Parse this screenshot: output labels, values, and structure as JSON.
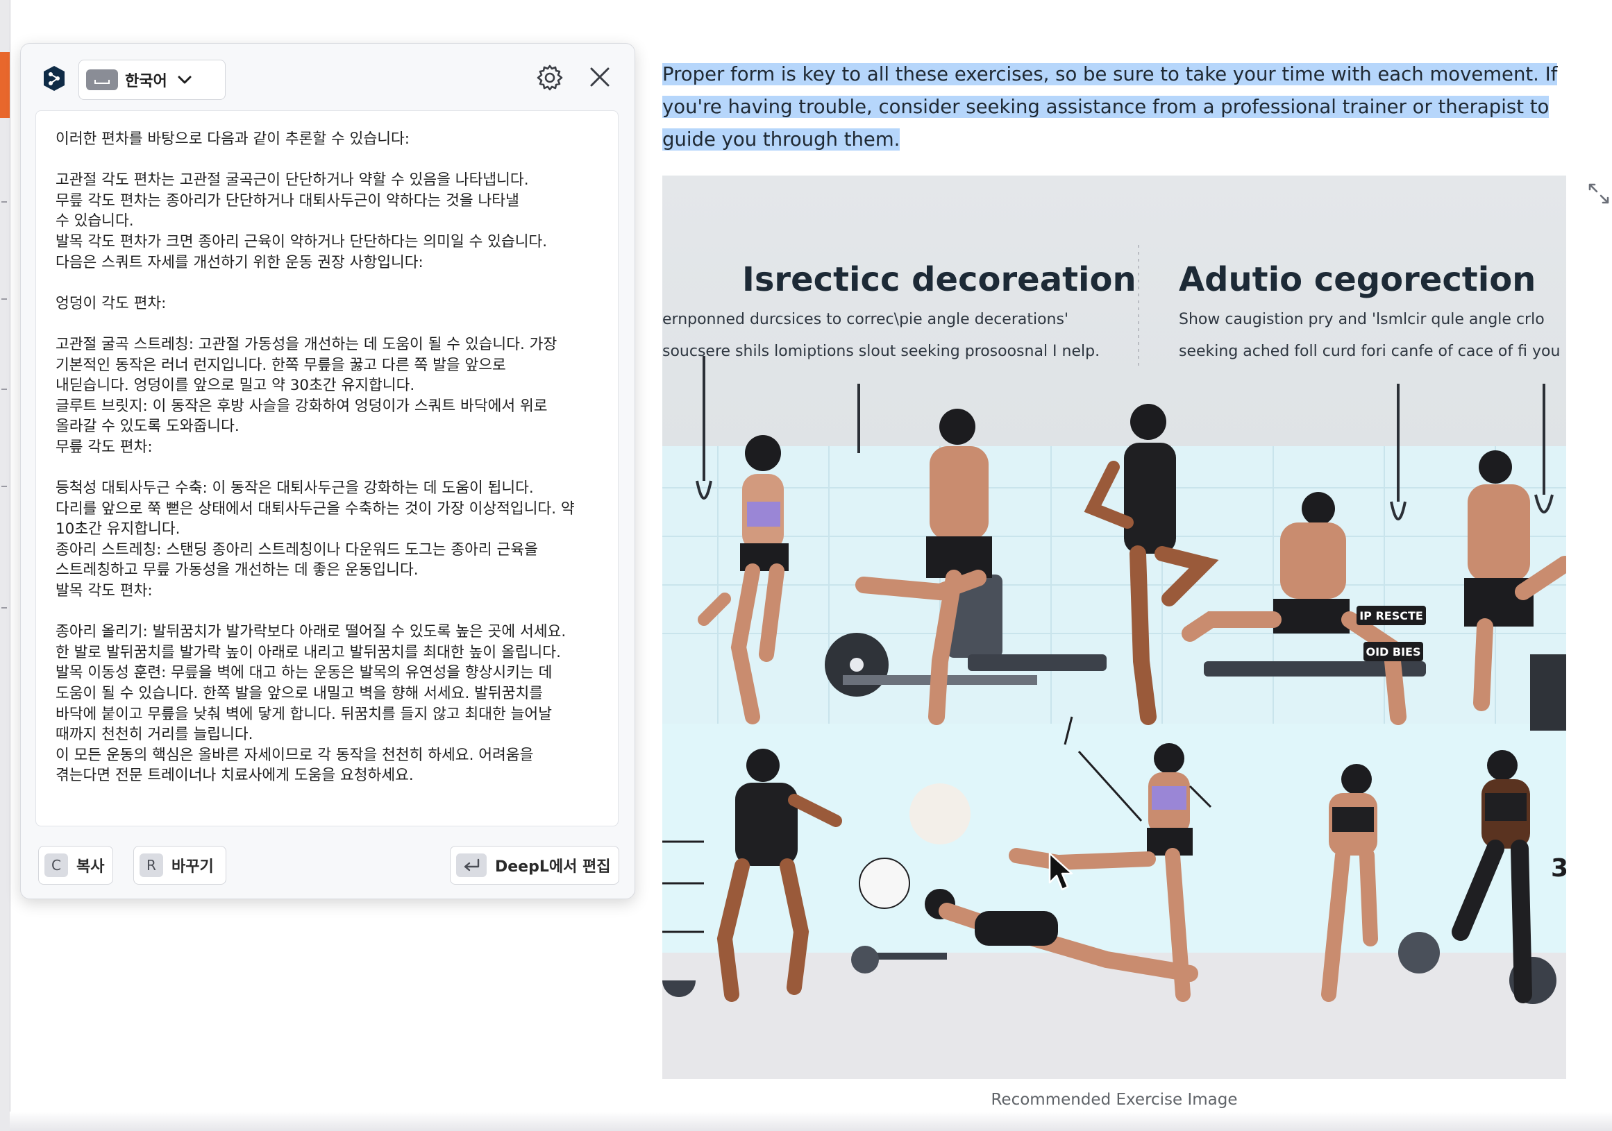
{
  "translator": {
    "language": "한국어",
    "text_lines": [
      "이러한 편차를 바탕으로 다음과 같이 추론할 수 있습니다:",
      "",
      "고관절 각도 편차는 고관절 굴곡근이 단단하거나 약할 수 있음을 나타냅니다.",
      "무릎 각도 편차는 종아리가 단단하거나 대퇴사두근이 약하다는 것을 나타낼",
      "수 있습니다.",
      "발목 각도 편차가 크면 종아리 근육이 약하거나 단단하다는 의미일 수 있습니다.",
      "다음은 스쿼트 자세를 개선하기 위한 운동 권장 사항입니다:",
      "",
      "엉덩이 각도 편차:",
      "",
      "고관절 굴곡 스트레칭: 고관절 가동성을 개선하는 데 도움이 될 수 있습니다. 가장",
      "기본적인 동작은 러너 런지입니다. 한쪽 무릎을 꿇고 다른 쪽 발을 앞으로",
      "내딛습니다. 엉덩이를 앞으로 밀고 약 30초간 유지합니다.",
      "글루트 브릿지: 이 동작은 후방 사슬을 강화하여 엉덩이가 스쿼트 바닥에서 위로",
      "올라갈 수 있도록 도와줍니다.",
      "무릎 각도 편차:",
      "",
      "등척성 대퇴사두근 수축: 이 동작은 대퇴사두근을 강화하는 데 도움이 됩니다.",
      "다리를 앞으로 쭉 뻗은 상태에서 대퇴사두근을 수축하는 것이 가장 이상적입니다. 약",
      "10초간 유지합니다.",
      "종아리 스트레칭: 스탠딩 종아리 스트레칭이나 다운워드 도그는 종아리 근육을",
      "스트레칭하고 무릎 가동성을 개선하는 데 좋은 운동입니다.",
      "발목 각도 편차:",
      "",
      "종아리 올리기: 발뒤꿈치가 발가락보다 아래로 떨어질 수 있도록 높은 곳에 서세요.",
      "한 발로 발뒤꿈치를 발가락 높이 아래로 내리고 발뒤꿈치를 최대한 높이 올립니다.",
      "발목 이동성 훈련: 무릎을 벽에 대고 하는 운동은 발목의 유연성을 향상시키는 데",
      "도움이 될 수 있습니다. 한쪽 발을 앞으로 내밀고 벽을 향해 서세요. 발뒤꿈치를",
      "바닥에 붙이고 무릎을 낮춰 벽에 닿게 합니다. 뒤꿈치를 들지 않고 최대한 늘어날",
      "때까지 천천히 거리를 늘립니다.",
      "이 모든 운동의 핵심은 올바른 자세이므로 각 동작을 천천히 하세요. 어려움을",
      "겪는다면 전문 트레이너나 치료사에게 도움을 요청하세요."
    ],
    "copy": {
      "key": "C",
      "label": "복사"
    },
    "replace": {
      "key": "R",
      "label": "바꾸기"
    },
    "edit": {
      "label": "DeepL에서 편집"
    }
  },
  "article": {
    "selected_paragraph": "Proper form is key to all these exercises, so be sure to take your time with each movement. If you're having trouble, consider seeking assistance from a professional trainer or therapist to guide you through them.",
    "image": {
      "title_left": "Isrecticc decoreation",
      "title_right": "Adutio cegorection",
      "sub_left_1": "ernponned durcsices to correc\\pie angle decerations'",
      "sub_left_2": "soucsere shils lomiptions slout seeking prosoosnal I nelp.",
      "sub_right_1": "Show caugistion pry and 'lsmlcir qule angle crlo",
      "sub_right_2": "seeking ached foll curd fori canfe of cace of fi you",
      "tag_1": "IP RESCTE",
      "tag_2": "OID BIES",
      "number": "3"
    },
    "caption": "Recommended Exercise Image"
  },
  "colors": {
    "selection": "#b6d6fb",
    "accent": "#0f2b46",
    "deepl_brand": "#0f2b46"
  }
}
